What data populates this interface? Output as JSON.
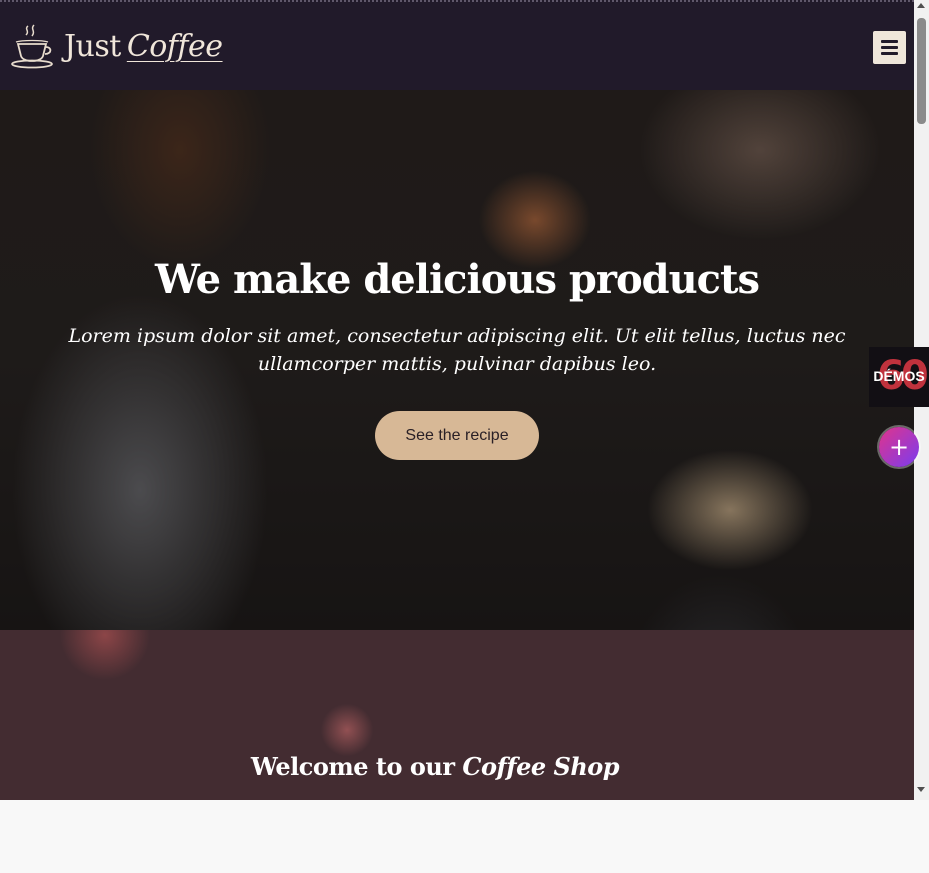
{
  "header": {
    "logo_word1": "Just",
    "logo_word2": "Coffee",
    "logo_icon": "coffee-cup-icon",
    "menu_icon": "hamburger-menu-icon"
  },
  "hero": {
    "title": "We make delicious products",
    "subtitle": "Lorem ipsum dolor sit amet, consectetur adipiscing elit. Ut elit tellus, luctus nec ullamcorper mattis, pulvinar dapibus leo.",
    "button_label": "See the recipe"
  },
  "section2": {
    "title_plain": "Welcome to our",
    "title_script": "Coffee Shop"
  },
  "widgets": {
    "demos_label": "DÉMOS",
    "demos_bg_text": "60",
    "plus_label": "+"
  },
  "colors": {
    "header_bg": "#211a2a",
    "accent": "#d7b896",
    "section2_bg": "#432c31",
    "logo_text": "#f0e6da"
  }
}
